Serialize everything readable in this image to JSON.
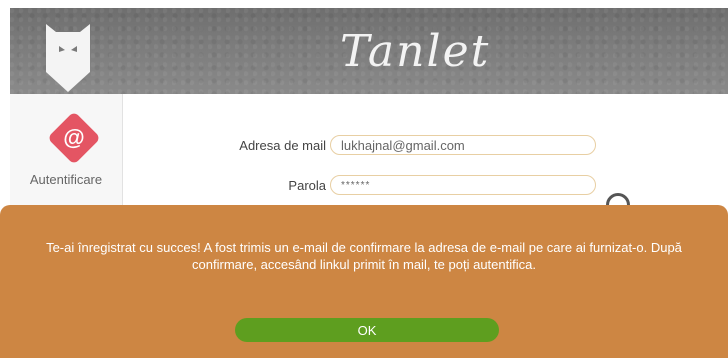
{
  "header": {
    "title": "Tanlet",
    "logo_icon": "fox-logo-icon"
  },
  "sidebar": {
    "auth_icon": "at-icon",
    "auth_symbol": "@",
    "auth_label": "Autentificare",
    "badge_color": "#e45563"
  },
  "form": {
    "email_label": "Adresa de mail",
    "email_value": "lukhajnal@gmail.com",
    "password_label": "Parola",
    "password_value": "******"
  },
  "dialog": {
    "message": "Te-ai înregistrat cu succes! A fost trimis un e-mail de confirmare la adresa de e-mail pe care ai furnizat-o. După confirmare, accesând linkul primit în mail, te poți autentifica.",
    "ok_label": "OK",
    "background_color": "#cd8643",
    "button_color": "#5e9e1f"
  }
}
